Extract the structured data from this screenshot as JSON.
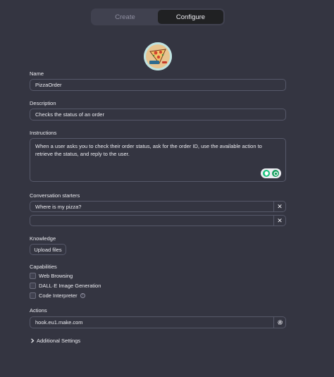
{
  "tabs": {
    "create": "Create",
    "configure": "Configure"
  },
  "name": {
    "label": "Name",
    "value": "PizzaOrder"
  },
  "description": {
    "label": "Description",
    "value": "Checks the status of an order"
  },
  "instructions": {
    "label": "Instructions",
    "value": "When a user asks you to check their order status, ask for the order ID, use the available action to retrieve the status, and reply to the user."
  },
  "starters": {
    "label": "Conversation starters",
    "items": [
      "Where is my pizza?",
      ""
    ],
    "remove_glyph": "✕"
  },
  "knowledge": {
    "label": "Knowledge",
    "upload_label": "Upload files"
  },
  "capabilities": {
    "label": "Capabilities",
    "items": [
      "Web Browsing",
      "DALL·E Image Generation",
      "Code Interpreter"
    ]
  },
  "actions": {
    "label": "Actions",
    "items": [
      "hook.eu1.make.com"
    ]
  },
  "additional_settings": "Additional Settings",
  "icons": {
    "avatar": "pizza-avatar",
    "remove": "close-icon",
    "gear": "gear-icon",
    "chevron": "chevron-right-icon",
    "info": "info-icon"
  },
  "colors": {
    "background": "#343541",
    "active_tab": "#202123",
    "border": "#565869",
    "accent_green": "#19c37d"
  }
}
